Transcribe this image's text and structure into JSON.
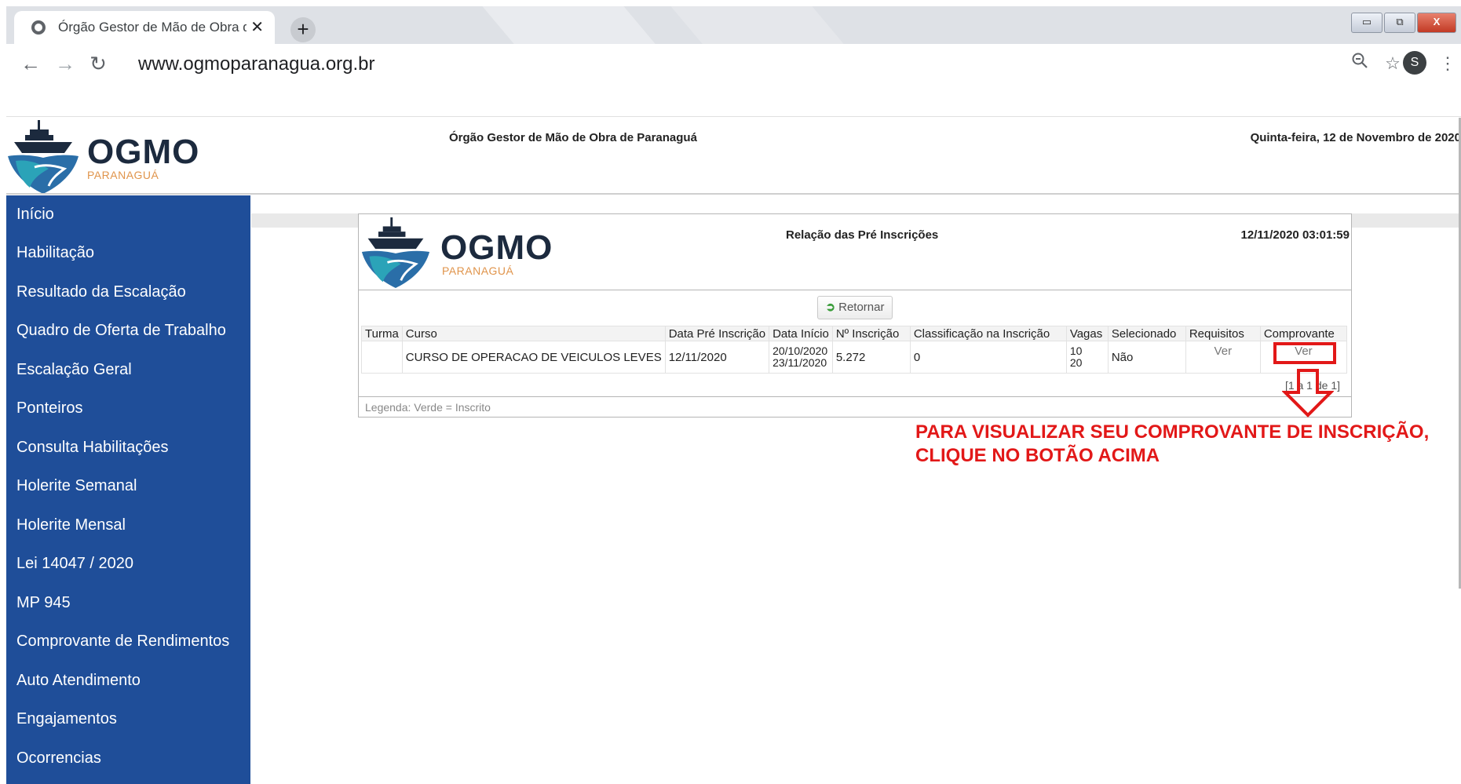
{
  "browser": {
    "tab_title": "Órgão Gestor de Mão de Obra d",
    "tab_close": "✕",
    "new_tab": "+",
    "url": "www.ogmoparanagua.org.br",
    "avatar_letter": "S",
    "window_buttons": [
      "▭",
      "⧉",
      "X"
    ]
  },
  "site": {
    "logo_word": "OGMO",
    "logo_sub": "PARANAGUÁ",
    "org_name": "Órgão Gestor de Mão de Obra de Paranaguá",
    "date": "Quinta-feira, 12 de Novembro de 2020"
  },
  "sidebar": {
    "items": [
      {
        "label": "Início"
      },
      {
        "label": "Habilitação"
      },
      {
        "label": "Resultado da Escalação"
      },
      {
        "label": "Quadro de Oferta de Trabalho"
      },
      {
        "label": "Escalação Geral"
      },
      {
        "label": "Ponteiros"
      },
      {
        "label": "Consulta Habilitações"
      },
      {
        "label": "Holerite Semanal"
      },
      {
        "label": "Holerite Mensal"
      },
      {
        "label": "Lei 14047 / 2020"
      },
      {
        "label": "MP 945"
      },
      {
        "label": "Comprovante de Rendimentos"
      },
      {
        "label": "Auto Atendimento"
      },
      {
        "label": "Engajamentos"
      },
      {
        "label": "Ocorrencias"
      }
    ]
  },
  "report": {
    "title": "Relação das Pré Inscrições",
    "timestamp": "12/11/2020 03:01:59",
    "return_button": "Retornar",
    "columns": [
      "Turma",
      "Curso",
      "Data Pré Inscrição",
      "Data Início",
      "Nº Inscrição",
      "Classificação na Inscrição",
      "Vagas",
      "Selecionado",
      "Requisitos",
      "Comprovante"
    ],
    "rows": [
      {
        "turma": "",
        "curso": "CURSO DE OPERACAO DE VEICULOS LEVES",
        "data_pre": "12/11/2020",
        "data_inicio_1": "20/10/2020",
        "data_inicio_2": "23/11/2020",
        "inscricao": "5.272",
        "classificacao": "0",
        "vagas_1": "10",
        "vagas_2": "20",
        "selecionado": "Não",
        "requisitos": "Ver",
        "comprovante": "Ver"
      }
    ],
    "pager": "[1 a 1 de 1]",
    "legend": "Legenda: Verde = Inscrito"
  },
  "annotation": {
    "line1": "PARA VISUALIZAR SEU COMPROVANTE DE INSCRIÇÃO,",
    "line2": "CLIQUE NO BOTÃO ACIMA",
    "color": "#e21818"
  },
  "colors": {
    "sidebar_bg": "#1f4e99",
    "logo_blue": "#2a6ea8",
    "logo_teal": "#2ba3b8",
    "logo_orange": "#e0944b"
  }
}
